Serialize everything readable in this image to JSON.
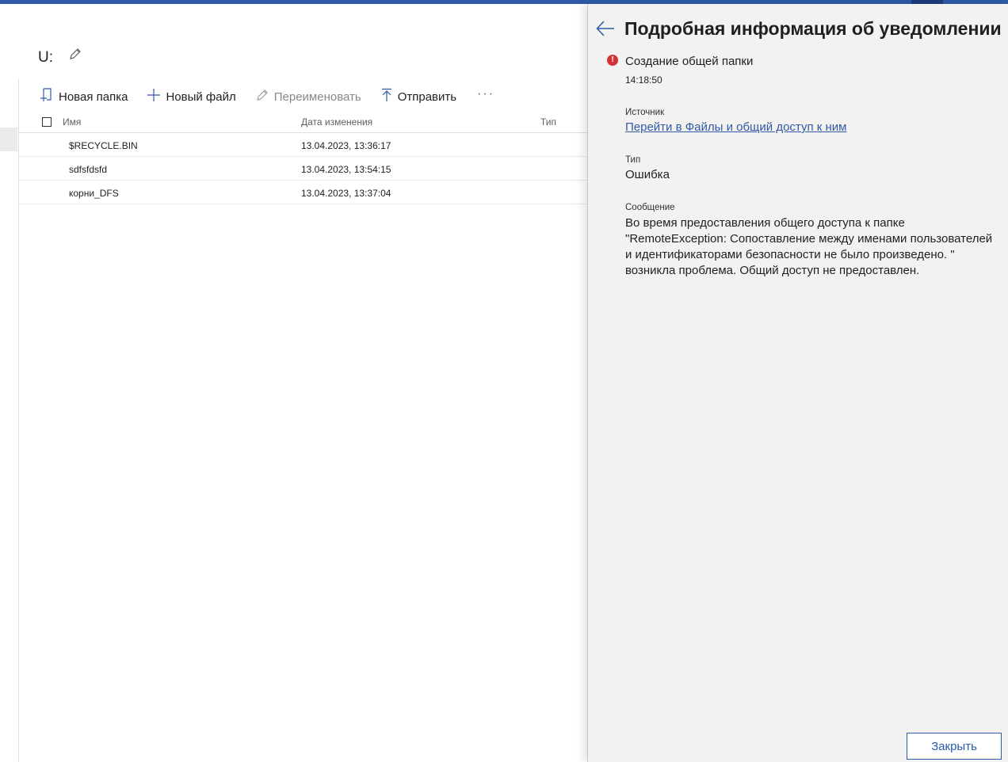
{
  "header": {
    "drive_title": "U:"
  },
  "toolbar": {
    "new_folder": "Новая папка",
    "new_file": "Новый файл",
    "rename": "Переименовать",
    "upload": "Отправить",
    "more": "···"
  },
  "table": {
    "columns": {
      "name": "Имя",
      "modified": "Дата изменения",
      "type": "Тип"
    },
    "rows": [
      {
        "name": "$RECYCLE.BIN",
        "modified": "13.04.2023, 13:36:17"
      },
      {
        "name": "sdfsfdsfd",
        "modified": "13.04.2023, 13:54:15"
      },
      {
        "name": "корни_DFS",
        "modified": "13.04.2023, 13:37:04"
      }
    ]
  },
  "panel": {
    "title": "Подробная информация об уведомлении",
    "notification_title": "Создание общей папки",
    "time": "14:18:50",
    "source_label": "Источник",
    "source_link": "Перейти в Файлы и общий доступ к ним",
    "type_label": "Тип",
    "type_value": "Ошибка",
    "message_label": "Сообщение",
    "message": "Во время предоставления общего доступа к папке \"RemoteException: Сопоставление между именами пользователей и идентификаторами безопасности не было произведено. \" возникла проблема. Общий доступ не предоставлен.",
    "close_button": "Закрыть"
  },
  "colors": {
    "accent": "#2e5aa8",
    "error": "#d13438",
    "panel_bg": "#f3f2f1"
  },
  "icons": [
    "pencil-icon",
    "new-folder-icon",
    "plus-icon",
    "rename-pencil-icon",
    "upload-icon",
    "back-arrow-icon",
    "error-icon"
  ]
}
